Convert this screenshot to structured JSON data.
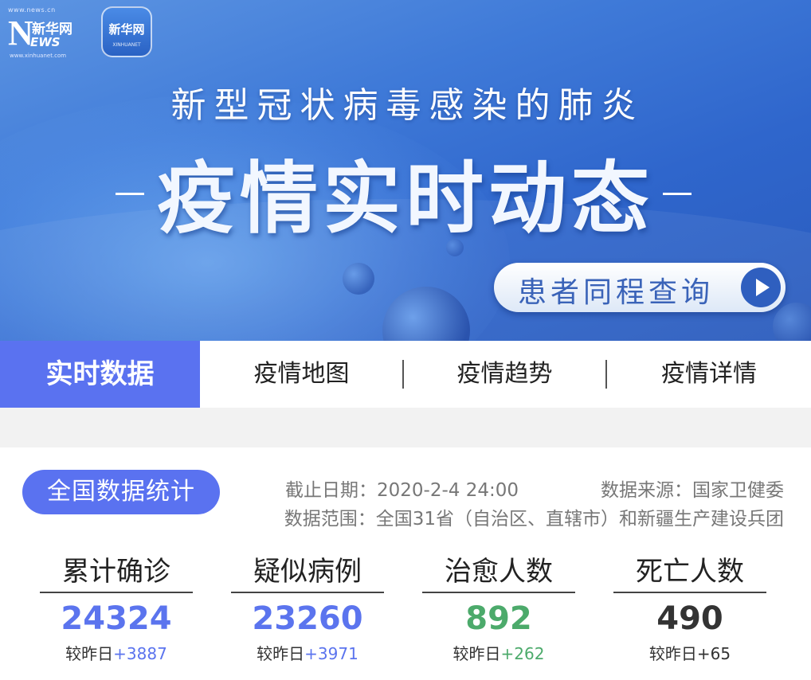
{
  "header": {
    "logo_site": "www.news.cn",
    "logo_n": "N",
    "logo_cn": "新华网",
    "logo_ews": "EWS",
    "logo_sub": "www.xinhuanet.com",
    "app_title": "新华网",
    "app_sub": "XINHUANET",
    "subtitle": "新型冠状病毒感染的肺炎",
    "title": "疫情实时动态",
    "query_button": "患者同程查询",
    "query_icon": "play-icon"
  },
  "tabs": [
    {
      "label": "实时数据",
      "active": true
    },
    {
      "label": "疫情地图",
      "active": false
    },
    {
      "label": "疫情趋势",
      "active": false
    },
    {
      "label": "疫情详情",
      "active": false
    }
  ],
  "stats": {
    "badge": "全国数据统计",
    "date": "截止日期：2020-2-4 24:00",
    "source": "数据来源：国家卫健委",
    "scope": "数据范围：全国31省（自治区、直辖市）和新疆生产建设兵团",
    "delta_prefix": "较昨日",
    "items": [
      {
        "label": "累计确诊",
        "value": "24324",
        "delta": "+3887",
        "color": "#5b74ee"
      },
      {
        "label": "疑似病例",
        "value": "23260",
        "delta": "+3971",
        "color": "#5b74ee"
      },
      {
        "label": "治愈人数",
        "value": "892",
        "delta": "+262",
        "color": "#4caa6b"
      },
      {
        "label": "死亡人数",
        "value": "490",
        "delta": "+65",
        "color": "#333333"
      }
    ]
  },
  "colors": {
    "accent": "#5a72f0",
    "banner": "#3f7ad8"
  }
}
